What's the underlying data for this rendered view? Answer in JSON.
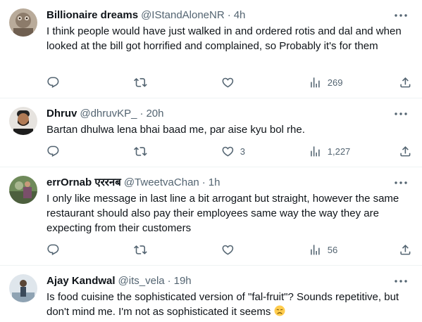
{
  "tweets": [
    {
      "name": "Billionaire dreams",
      "handle": "@IStandAloneNR",
      "time": "4h",
      "text": "I think people would have just walked in and ordered rotis and dal and when looked at the bill got horrified and complained, so Probably it's for them",
      "replies": "",
      "retweets": "",
      "likes": "",
      "views": "269"
    },
    {
      "name": "Dhruv",
      "handle": "@dhruvKP_",
      "time": "20h",
      "text": "Bartan dhulwa lena bhai baad me, par aise kyu bol rhe.",
      "replies": "",
      "retweets": "",
      "likes": "3",
      "views": "1,227"
    },
    {
      "name": "errOrnab एररनब",
      "handle": "@TweetvaChan",
      "time": "1h",
      "text": "I only like message in last line a bit arrogant but straight, however the same restaurant should also pay their employees same way the way they are expecting from their customers",
      "replies": "",
      "retweets": "",
      "likes": "",
      "views": "56"
    },
    {
      "name": "Ajay Kandwal",
      "handle": "@its_vela",
      "time": "19h",
      "text": "Is food cuisine the sophisticated version of \"fal-fruit\"? Sounds repetitive, but don't mind me. I'm not as sophisticated it seems",
      "emoji": "disappointed-face",
      "replies": "",
      "retweets": "",
      "likes": "",
      "views": ""
    }
  ],
  "separator": "·",
  "colors": {
    "text": "#0f1419",
    "secondary": "#536471",
    "border": "#eff3f4"
  }
}
